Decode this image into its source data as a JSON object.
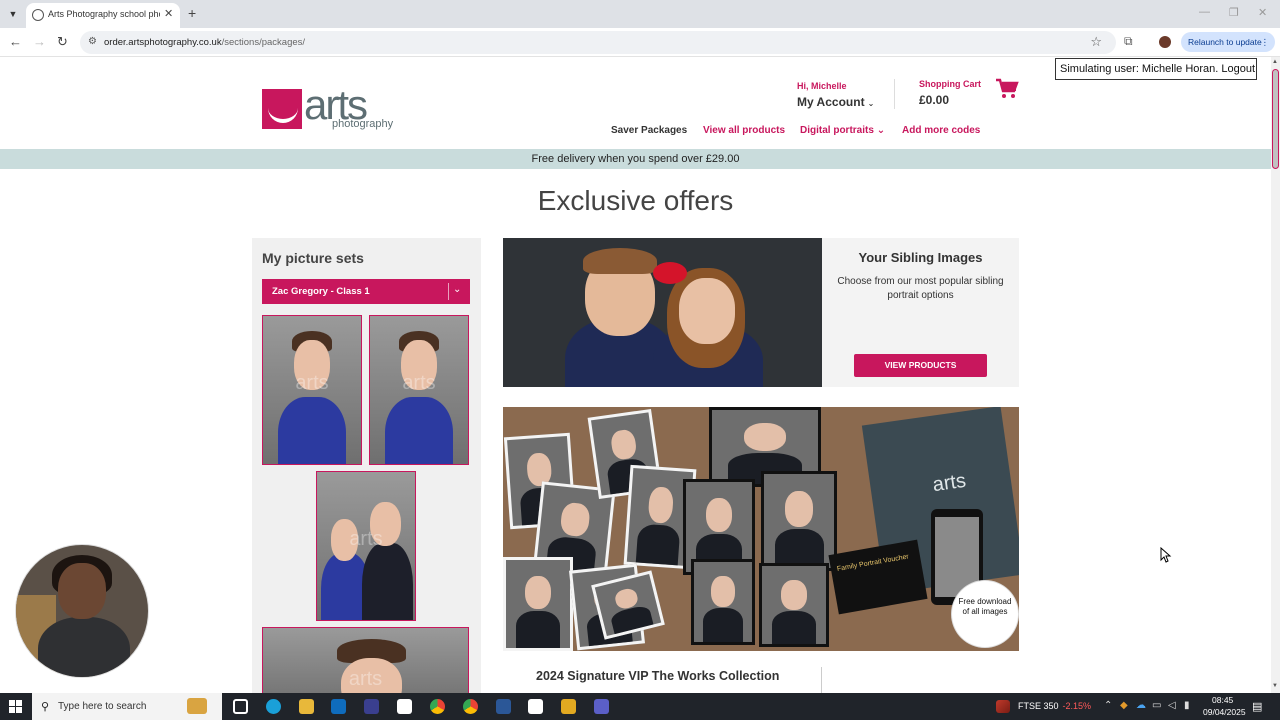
{
  "browser": {
    "tab_title": "Arts Photography school photo",
    "url_host": "order.artsphotography.co.uk",
    "url_path": "/sections/packages/",
    "relaunch_label": "Relaunch to update"
  },
  "header": {
    "logo_text": "arts",
    "logo_subtext": "photography",
    "greeting": "Hi, Michelle",
    "account_label": "My Account",
    "cart_label": "Shopping Cart",
    "cart_total": "£0.00",
    "simulating_text": "Simulating user: Michelle Horan.",
    "logout_label": "Logout"
  },
  "nav": {
    "saver": "Saver Packages",
    "view_all": "View all products",
    "digital": "Digital portraits",
    "add_codes": "Add more codes"
  },
  "delivery_banner": "Free delivery when you spend over £29.00",
  "page_heading": "Exclusive offers",
  "sidebar": {
    "title": "My picture sets",
    "selected_set": "Zac Gregory - Class 1",
    "watermark": "arts"
  },
  "offers": [
    {
      "title": "Your Sibling Images",
      "description": "Choose from our most popular sibling portrait options",
      "button": "VIEW PRODUCTS"
    },
    {
      "title": "2024 Signature VIP The Works Collection",
      "image_folder_text": "arts",
      "voucher_text": "Family Portrait Voucher",
      "badge_text": "Free download of all images"
    }
  ],
  "taskbar": {
    "search_placeholder": "Type here to search",
    "ftse_label": "FTSE 350",
    "ftse_change": "-2.15%",
    "time": "08:45",
    "date": "09/04/2025"
  },
  "colors": {
    "brand": "#c8175d",
    "logo_grey": "#5d6e73",
    "banner": "#c9dcdc"
  }
}
